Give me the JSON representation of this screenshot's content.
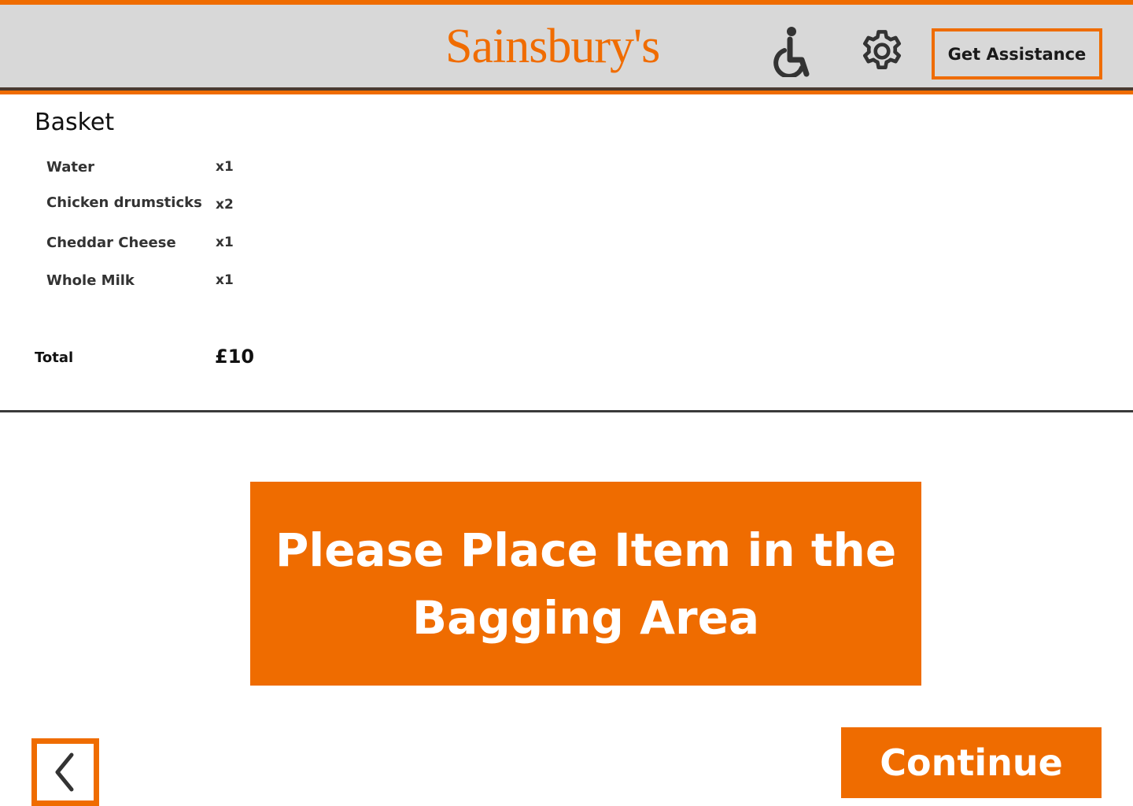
{
  "header": {
    "brand": "Sainsbury's",
    "assist_label": "Get Assistance",
    "accessibility_icon": "accessibility-icon",
    "settings_icon": "gear-icon"
  },
  "basket": {
    "title": "Basket",
    "items": [
      {
        "name": "Water",
        "qty": "x1"
      },
      {
        "name": "Chicken drumsticks",
        "qty": "x2"
      },
      {
        "name": "Cheddar Cheese",
        "qty": "x1"
      },
      {
        "name": "Whole Milk",
        "qty": "x1"
      }
    ],
    "total_label": "Total",
    "total_value": "£10"
  },
  "message": "Please Place Item in the Bagging Area",
  "continue_label": "Continue",
  "back_icon": "chevron-left-icon",
  "colors": {
    "accent": "#ef6c00",
    "header_bg": "#d8d8d8",
    "text": "#111111"
  }
}
